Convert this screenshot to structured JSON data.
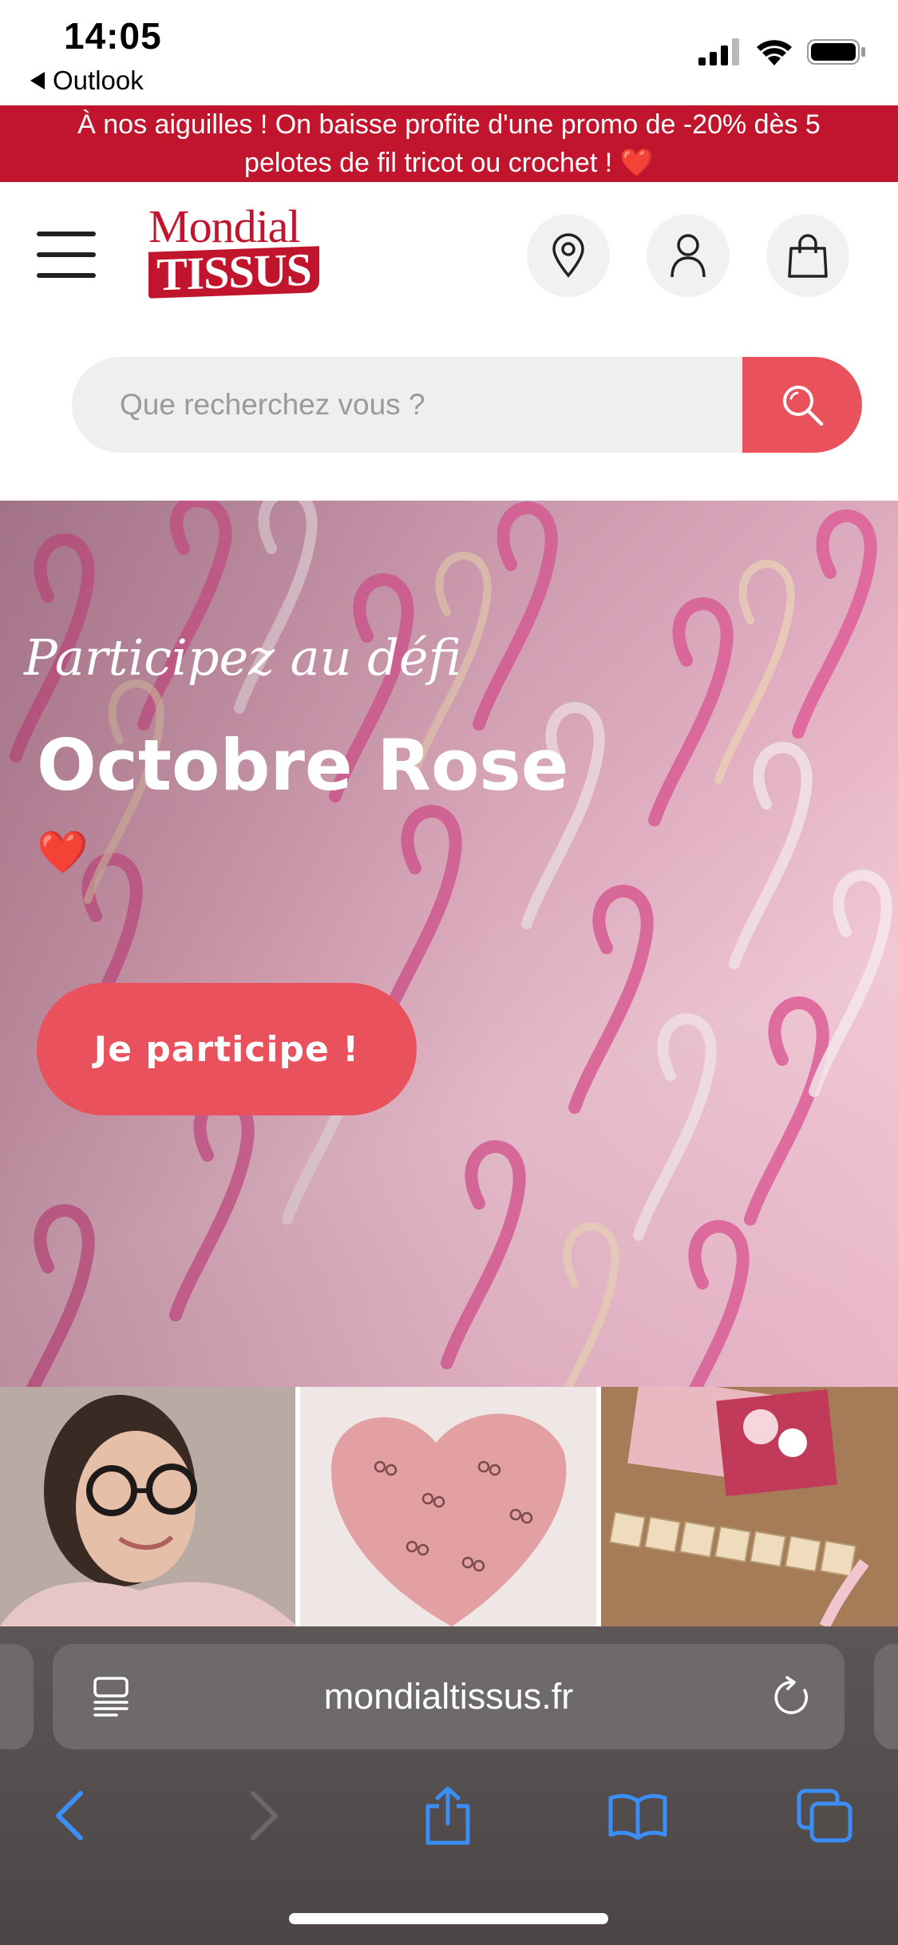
{
  "status_bar": {
    "time": "14:05",
    "back_app": "Outlook",
    "icons": [
      "signal-icon",
      "wifi-icon",
      "battery-icon"
    ]
  },
  "promo": {
    "text": "À nos aiguilles ! On baisse profite d'une promo de -20% dès 5 pelotes de fil tricot ou crochet ! ❤️",
    "background": "#c0152c"
  },
  "header": {
    "logo_line1": "Mondial",
    "logo_line2": "TISSUS",
    "icons": [
      "store-location-icon",
      "account-icon",
      "cart-icon"
    ],
    "brand_color": "#c0152c"
  },
  "search": {
    "placeholder": "Que recherchez vous ?",
    "button_color": "#e9525c"
  },
  "hero": {
    "script_line": "Participez au défi",
    "title": "Octobre Rose",
    "heart": "❤️",
    "cta": "Je participe !",
    "cta_color": "#e9525c"
  },
  "browser": {
    "url": "mondialtissus.fr",
    "accent": "#3a8ef6"
  }
}
